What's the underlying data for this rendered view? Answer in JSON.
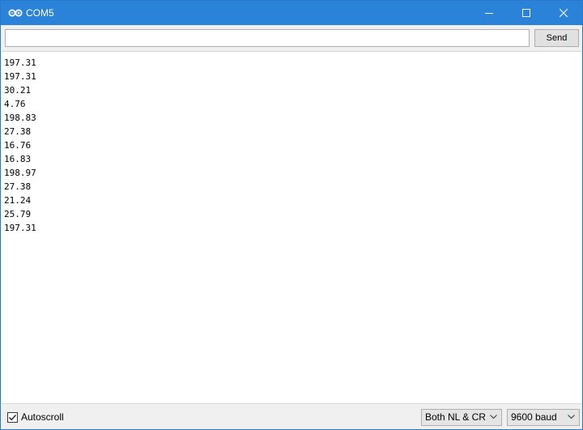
{
  "window": {
    "title": "COM5"
  },
  "icons": {
    "app": "arduino-infinity-icon",
    "minimize": "minimize-icon",
    "maximize": "maximize-icon",
    "close": "close-icon",
    "chevron": "chevron-down-icon",
    "check": "checkmark-icon"
  },
  "toolbar": {
    "input_value": "",
    "send_label": "Send"
  },
  "output": {
    "lines": [
      "197.31",
      "197.31",
      "30.21",
      "4.76",
      "198.83",
      "27.38",
      "16.76",
      "16.83",
      "198.97",
      "27.38",
      "21.24",
      "25.79",
      "197.31"
    ]
  },
  "statusbar": {
    "autoscroll_label": "Autoscroll",
    "autoscroll_checked": true,
    "line_ending": "Both NL & CR",
    "baud_rate": "9600 baud"
  },
  "colors": {
    "titlebar": "#2b82d9",
    "background": "#f0f0f0"
  }
}
